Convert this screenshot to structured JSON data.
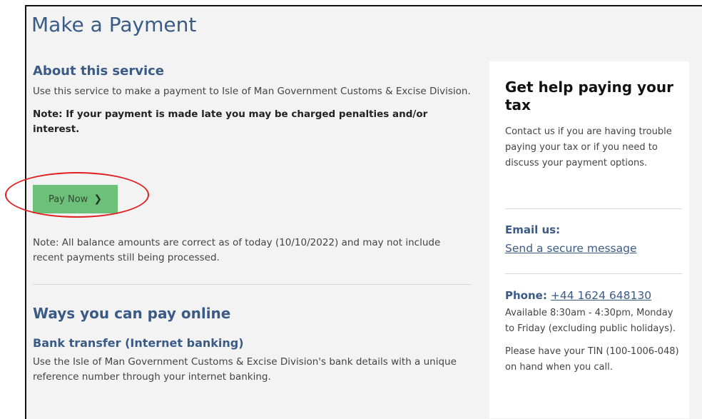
{
  "page": {
    "title": "Make a Payment"
  },
  "about": {
    "heading": "About this service",
    "description": "Use this service to make a payment to Isle of Man Government Customs & Excise Division.",
    "note_bold": "Note: If your payment is made late you may be charged penalties and/or interest.",
    "pay_button_label": "Pay Now",
    "pay_button_icon": "chevron-right-icon",
    "balance_note": "Note: All balance amounts are correct as of today (10/10/2022) and may not include recent payments still being processed."
  },
  "ways": {
    "heading": "Ways you can pay online",
    "bank_transfer": {
      "heading": "Bank transfer (Internet banking)",
      "description": "Use the Isle of Man Government Customs & Excise Division's bank details with a unique reference number through your internet banking."
    }
  },
  "help": {
    "title": "Get help paying your tax",
    "intro": "Contact us if you are having trouble paying your tax or if you need to discuss your payment options.",
    "email_heading": "Email us:",
    "email_link": "Send a secure message",
    "phone_label": "Phone:",
    "phone_number": "+44 1624 648130",
    "hours": "Available 8:30am - 4:30pm, Monday to Friday (excluding public holidays).",
    "tin_note": "Please have your TIN (100-1006-048) on hand when you call."
  },
  "colors": {
    "heading_blue": "#3b5b87",
    "button_green": "#6cc07a",
    "annotation_red": "#e02020",
    "panel_bg": "#f3f3f3"
  }
}
